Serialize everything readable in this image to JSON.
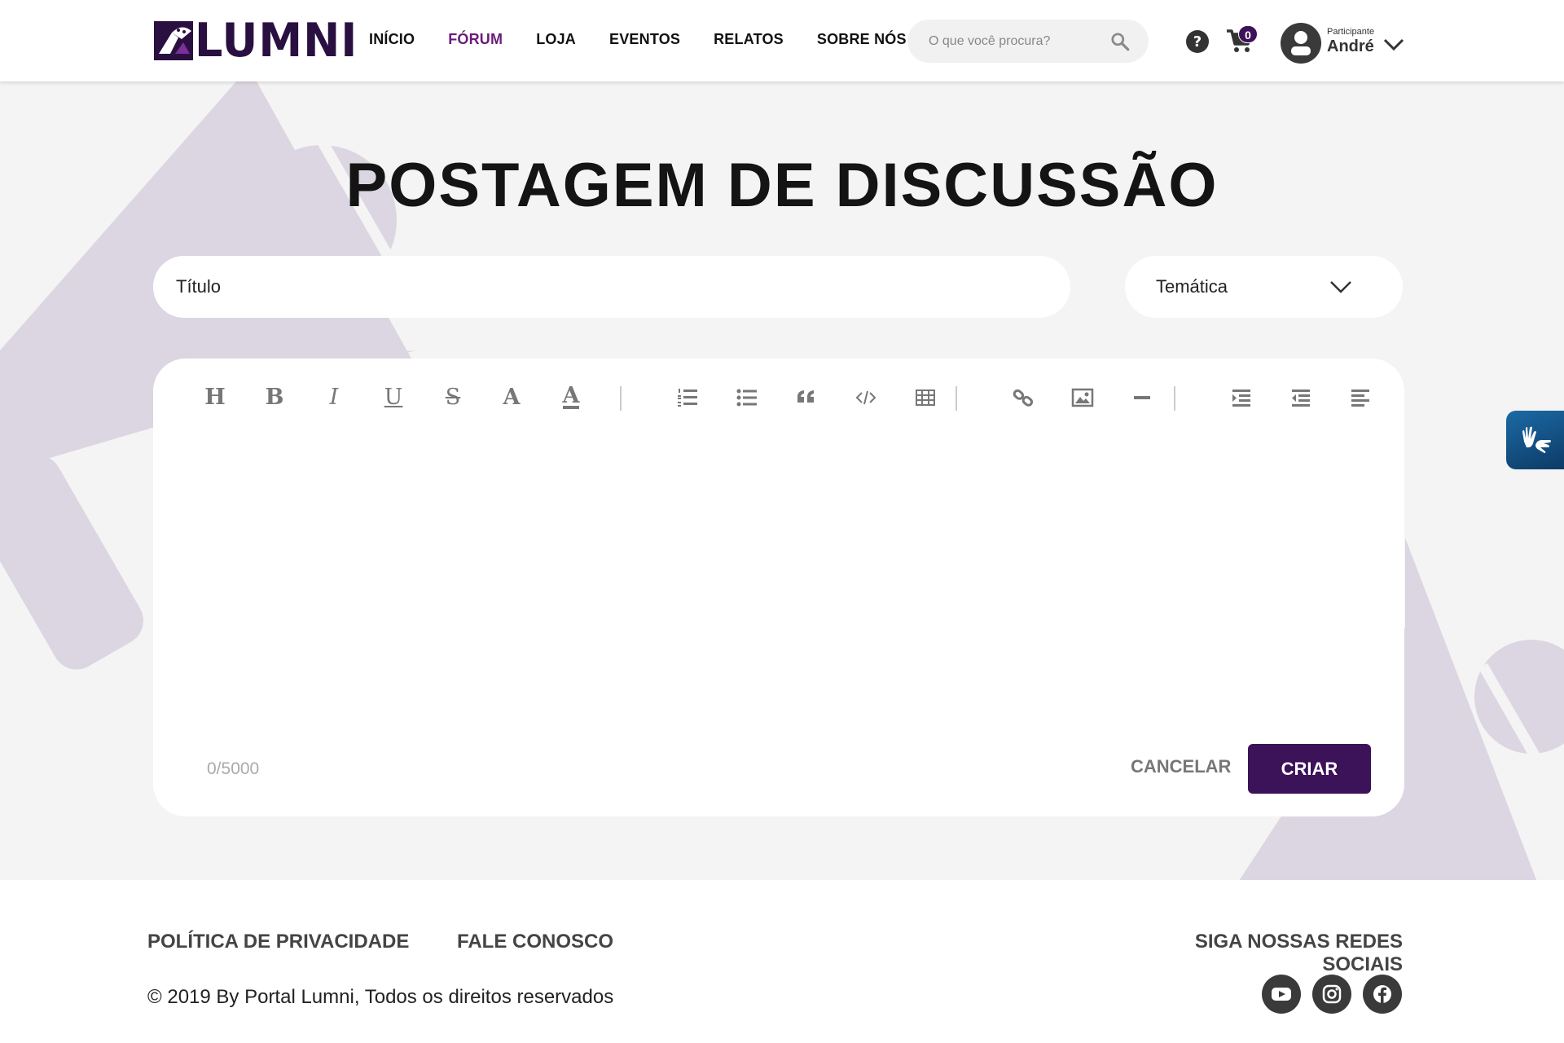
{
  "header": {
    "logo_text": "LUMNI",
    "nav": [
      {
        "label": "INÍCIO",
        "active": false
      },
      {
        "label": "FÓRUM",
        "active": true
      },
      {
        "label": "LOJA",
        "active": false
      },
      {
        "label": "EVENTOS",
        "active": false
      },
      {
        "label": "RELATOS",
        "active": false
      },
      {
        "label": "SOBRE NÓS",
        "active": false
      }
    ],
    "search_placeholder": "O que você procura?",
    "cart_count": "0",
    "user_role": "Participante",
    "user_name": "André",
    "accent_color": "#6a1b7a",
    "brand_color": "#3c1259"
  },
  "main": {
    "page_title": "POSTAGEM DE DISCUSSÃO",
    "title_placeholder": "Título",
    "theme_select_label": "Temática",
    "toolbar": [
      "heading-icon",
      "bold-icon",
      "italic-icon",
      "underline-icon",
      "strikethrough-icon",
      "text-color-icon",
      "highlight-icon",
      "ordered-list-icon",
      "unordered-list-icon",
      "quote-icon",
      "code-icon",
      "table-icon",
      "link-icon",
      "image-icon",
      "horizontal-rule-icon",
      "indent-icon",
      "outdent-icon",
      "align-left-icon"
    ],
    "char_count": "0/5000",
    "cancel_label": "CANCELAR",
    "create_label": "CRIAR"
  },
  "footer": {
    "privacy_label": "POLÍTICA DE PRIVACIDADE",
    "contact_label": "FALE CONOSCO",
    "social_label": "SIGA NOSSAS REDES SOCIAIS",
    "copyright": "© 2019 By Portal Lumni, Todos os direitos reservados",
    "social": [
      "youtube-icon",
      "instagram-icon",
      "facebook-icon"
    ]
  }
}
